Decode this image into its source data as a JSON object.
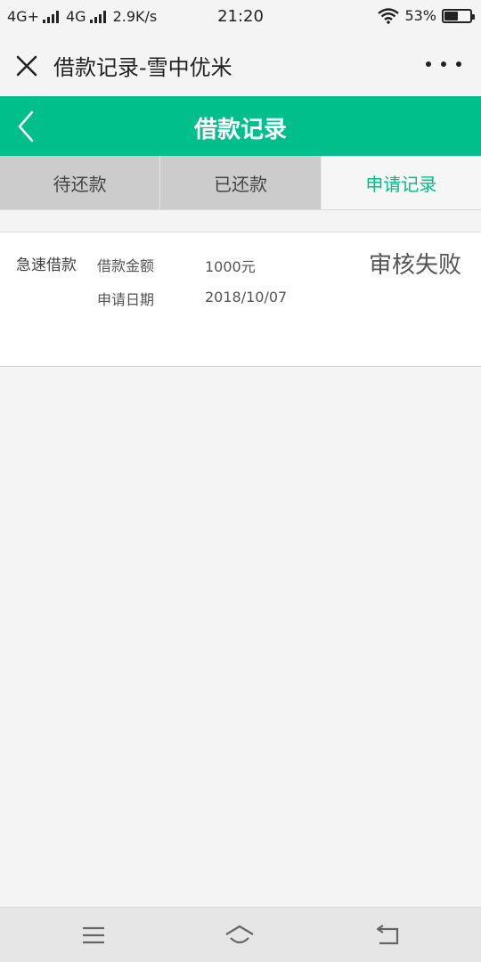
{
  "status_bar": {
    "network1": "4G+",
    "network2": "4G",
    "speed": "2.9K/s",
    "time": "21:20",
    "battery_text": "53%",
    "battery_level": 0.53
  },
  "webview": {
    "title": "借款记录-雪中优米",
    "close_icon": "close-icon",
    "more_icon": "more-dots-icon"
  },
  "app_bar": {
    "title": "借款记录",
    "back_icon": "chevron-left-icon",
    "color": "#00bf8a"
  },
  "tabs": [
    {
      "label": "待还款",
      "active": false
    },
    {
      "label": "已还款",
      "active": false
    },
    {
      "label": "申请记录",
      "active": true
    }
  ],
  "records": [
    {
      "type": "急速借款",
      "amount_label": "借款金额",
      "amount_value": "1000元",
      "date_label": "申请日期",
      "date_value": "2018/10/07",
      "status": "审核失败"
    }
  ],
  "nav_bar": {
    "menu_icon": "menu-icon",
    "home_icon": "home-icon",
    "back_icon": "back-arrow-icon"
  }
}
